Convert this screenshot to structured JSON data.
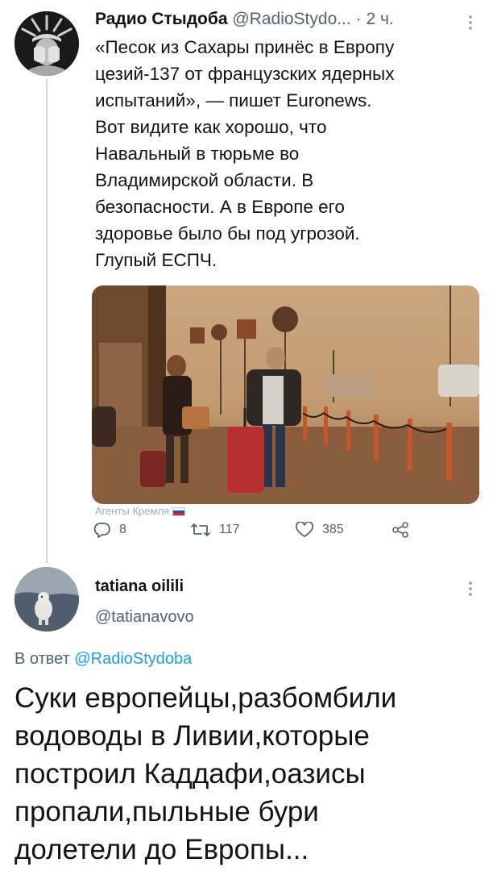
{
  "tweet": {
    "author_name": "Радио Стыдоба",
    "author_handle": "@RadioStydo...",
    "separator": "·",
    "time": "2 ч.",
    "text_lines": [
      "«Песок из Сахары принёс в Европу",
      "цезий-137 от французских ядерных",
      "испытаний», — пишет Euronews.",
      "Вот видите как хорошо, что",
      "Навальный в тюрьме во",
      "Владимирской области. В",
      "безопасности. А в Европе его",
      "здоровье было бы под угрозой.",
      "Глупый ЕСПЧ."
    ],
    "image_watermark": "Агенты Кремля",
    "replies": "8",
    "retweets": "117",
    "likes": "385",
    "icons": [
      "more-icon",
      "reply-icon",
      "retweet-icon",
      "like-icon",
      "share-icon"
    ]
  },
  "reply": {
    "author_name": "tatiana oilili",
    "author_handle": "@tatianavovo",
    "in_reply_to_prefix": "В ответ",
    "in_reply_to_handle": "@RadioStydoba",
    "text_lines": [
      "Суки европейцы,разбомбили",
      "водоводы в Ливии,которые",
      "построил Каддафи,оазисы",
      "пропали,пыльные бури",
      "долетели до Европы..."
    ]
  },
  "colors": {
    "text": "#0f1419",
    "secondary": "#536471",
    "link": "#1d9bf0",
    "thread_line": "#cfd9de"
  }
}
